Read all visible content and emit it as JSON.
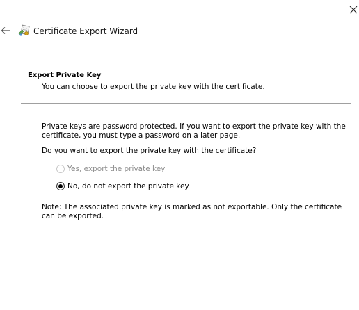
{
  "window": {
    "close_icon": "close-icon",
    "back_icon": "back-arrow-icon",
    "title_icon": "certificate-wizard-icon",
    "title": "Certificate Export Wizard"
  },
  "page": {
    "header": "Export Private Key",
    "subheader": "You can choose to export the private key with the certificate.",
    "info_line1": "Private keys are password protected. If you want to export the private key with the",
    "info_line2": "certificate, you must type a password on a later page.",
    "question": "Do you want to export the private key with the certificate?",
    "options": [
      {
        "label": "Yes, export the private key",
        "selected": false,
        "enabled": false
      },
      {
        "label": "No, do not export the private key",
        "selected": true,
        "enabled": true
      }
    ],
    "note_line1": "Note: The associated private key is marked as not exportable. Only the certificate",
    "note_line2": "can be exported."
  }
}
